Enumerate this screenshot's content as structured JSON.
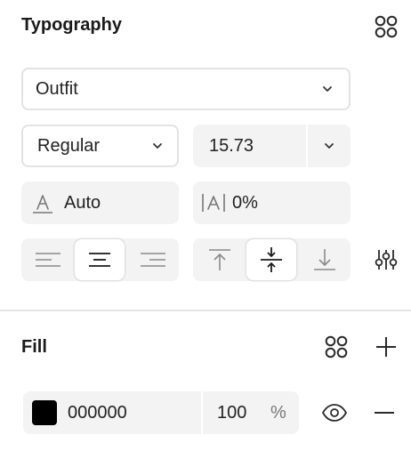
{
  "typography": {
    "title": "Typography",
    "font_family": "Outfit",
    "font_weight": "Regular",
    "font_size": "15.73",
    "line_height": "Auto",
    "letter_spacing": "0%"
  },
  "fill": {
    "title": "Fill",
    "color_hex": "000000",
    "swatch_color": "#000000",
    "opacity_value": "100",
    "opacity_unit": "%"
  },
  "icons": {
    "component_menu": "four-circles-icon",
    "text_options": "sliders-icon",
    "add": "plus-icon",
    "remove": "minus-icon",
    "visibility": "eye-icon"
  }
}
